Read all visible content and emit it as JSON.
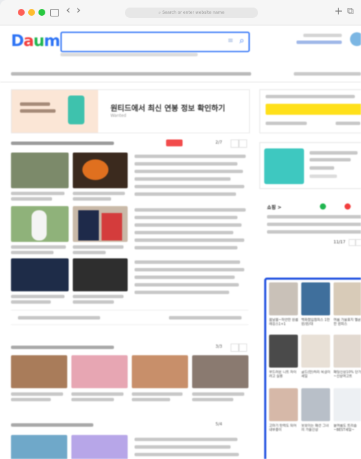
{
  "browser": {
    "url_placeholder": "Search or enter website name",
    "plus_glyph": "+",
    "back_glyph": "‹",
    "forward_glyph": "›",
    "tabs_glyph": "⧉"
  },
  "header": {
    "logo": "Daum",
    "logo_colors": [
      "#2d73f5",
      "#f23d3d",
      "#1fb54f",
      "#f0b400"
    ]
  },
  "promo": {
    "title": "원티드에서 최신 연봉 정보 확인하기",
    "sub": "Wanted"
  },
  "news": {
    "page_indicator": "2/7"
  },
  "video": {
    "page_indicator": "3/3"
  },
  "bottom": {
    "page_indicator": "5/4"
  },
  "shopping": {
    "title": "쇼핑 >",
    "page_indicator": "11/17",
    "products": [
      {
        "label": "봄날봄~하얀한 원룸레깅스1+1",
        "color": "#c9c1b8"
      },
      {
        "label": "백화점입점피스 1만원/원/대",
        "color": "#3f6f9c"
      },
      {
        "label": "여름 가을표지 멜론한 원피스",
        "color": "#d8cbb8"
      },
      {
        "label": "부드러운 니트 자이러고 실용",
        "color": "#4a4a4a"
      },
      {
        "label": "골드(만)히리 목걸이 세일",
        "color": "#e8e0d6"
      },
      {
        "label": "패딩신상10% 단가~신상여고트",
        "color": "#e2d9d0"
      },
      {
        "label": "고마기 탄력도 되어 내부충이",
        "color": "#d6b8a8"
      },
      {
        "label": "옷보이는 패션 그녀의 가을신상",
        "color": "#b8bfc8"
      },
      {
        "label": "올여름도 트리좀 ~BEST세일~",
        "color": "#edf0f3"
      }
    ]
  }
}
